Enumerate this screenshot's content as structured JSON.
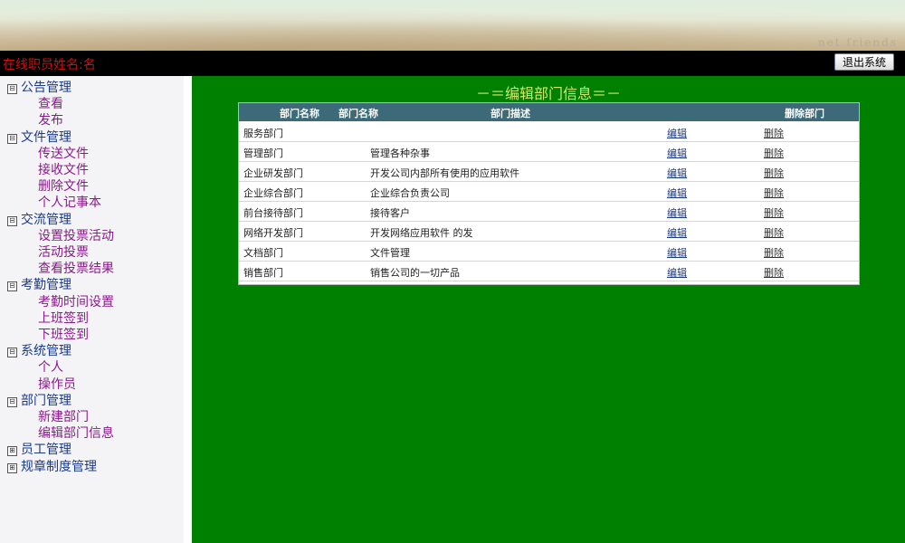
{
  "banner": {
    "faint_text": "net friends"
  },
  "header": {
    "user_label": "在线职员姓名:名",
    "logout_label": "退出系统"
  },
  "sidebar": {
    "groups": [
      {
        "label": "公告管理",
        "toggle": "⊟",
        "items": [
          "查看",
          "发布"
        ]
      },
      {
        "label": "文件管理",
        "toggle": "⊟",
        "items": [
          "传送文件",
          "接收文件",
          "删除文件",
          "个人记事本"
        ]
      },
      {
        "label": "交流管理",
        "toggle": "⊟",
        "items": [
          "设置投票活动",
          "活动投票",
          "查看投票结果"
        ]
      },
      {
        "label": "考勤管理",
        "toggle": "⊟",
        "items": [
          "考勤时间设置",
          "上班签到",
          "下班签到"
        ]
      },
      {
        "label": "系统管理",
        "toggle": "⊟",
        "items": [
          "个人",
          "操作员"
        ]
      },
      {
        "label": "部门管理",
        "toggle": "⊟",
        "items": [
          "新建部门",
          "编辑部门信息"
        ]
      },
      {
        "label": "员工管理",
        "toggle": "⊞",
        "items": []
      },
      {
        "label": "规章制度管理",
        "toggle": "⊞",
        "items": []
      }
    ]
  },
  "main": {
    "title": "－＝编辑部门信息＝－",
    "table": {
      "headers": [
        "部门名称",
        "部门名称",
        "部门描述",
        "删除部门"
      ],
      "edit_label": "编辑",
      "delete_label": "删除",
      "rows": [
        {
          "name": "服务部门",
          "desc": ""
        },
        {
          "name": "管理部门",
          "desc": "管理各种杂事"
        },
        {
          "name": "企业研发部门",
          "desc": "开发公司内部所有使用的应用软件"
        },
        {
          "name": "企业综合部门",
          "desc": "企业综合负责公司"
        },
        {
          "name": "前台接待部门",
          "desc": "接待客户"
        },
        {
          "name": "网络开发部门",
          "desc": "开发网络应用软件 的发"
        },
        {
          "name": "文档部门",
          "desc": "文件管理"
        },
        {
          "name": "销售部门",
          "desc": "销售公司的一切产品"
        }
      ]
    }
  }
}
